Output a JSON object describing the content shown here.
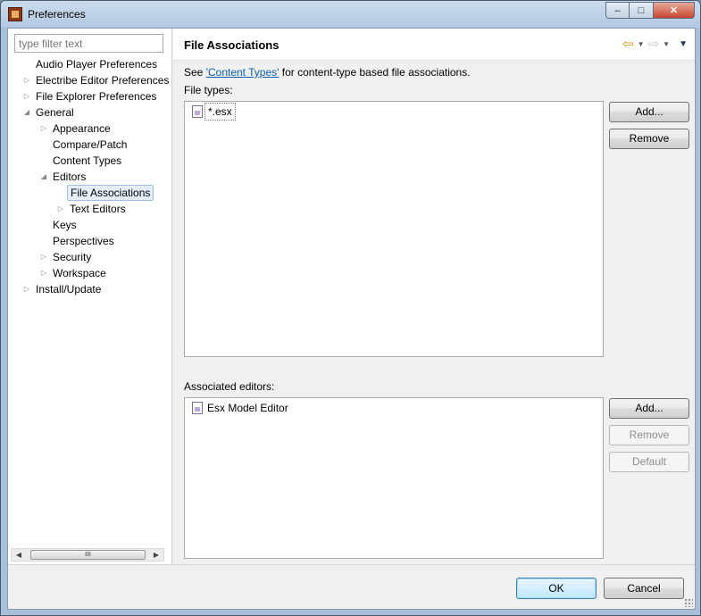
{
  "window": {
    "title": "Preferences",
    "minimize": "–",
    "maximize": "□",
    "close": "✕"
  },
  "filter": {
    "placeholder": "type filter text"
  },
  "tree": [
    {
      "label": "Audio Player Preferences",
      "expandable": false,
      "expanded": false,
      "selected": false
    },
    {
      "label": "Electribe Editor Preferences",
      "expandable": true,
      "expanded": false,
      "selected": false
    },
    {
      "label": "File Explorer Preferences",
      "expandable": true,
      "expanded": false,
      "selected": false
    },
    {
      "label": "General",
      "expandable": true,
      "expanded": true,
      "selected": false
    },
    {
      "label": "Appearance",
      "expandable": true,
      "expanded": false,
      "selected": false
    },
    {
      "label": "Compare/Patch",
      "expandable": false,
      "expanded": false,
      "selected": false
    },
    {
      "label": "Content Types",
      "expandable": false,
      "expanded": false,
      "selected": false
    },
    {
      "label": "Editors",
      "expandable": true,
      "expanded": true,
      "selected": false
    },
    {
      "label": "File Associations",
      "expandable": false,
      "expanded": false,
      "selected": true
    },
    {
      "label": "Text Editors",
      "expandable": true,
      "expanded": false,
      "selected": false
    },
    {
      "label": "Keys",
      "expandable": false,
      "expanded": false,
      "selected": false
    },
    {
      "label": "Perspectives",
      "expandable": false,
      "expanded": false,
      "selected": false
    },
    {
      "label": "Security",
      "expandable": true,
      "expanded": false,
      "selected": false
    },
    {
      "label": "Workspace",
      "expandable": true,
      "expanded": false,
      "selected": false
    },
    {
      "label": "Install/Update",
      "expandable": true,
      "expanded": false,
      "selected": false
    }
  ],
  "page": {
    "title": "File Associations",
    "see_prefix": "See ",
    "see_link": "'Content Types'",
    "see_suffix": " for content-type based file associations.",
    "file_types_label": "File types:",
    "file_types": [
      "*.esx"
    ],
    "file_types_add": "Add...",
    "file_types_remove": "Remove",
    "editors_label": "Associated editors:",
    "editors": [
      "Esx Model Editor"
    ],
    "editors_add": "Add...",
    "editors_remove": "Remove",
    "editors_default": "Default"
  },
  "footer": {
    "ok": "OK",
    "cancel": "Cancel"
  },
  "icons": {
    "back": "arrow-left-icon",
    "forward": "arrow-right-icon",
    "menu": "view-menu-icon",
    "file": "esx-file-icon",
    "expand_collapsed": "▷",
    "expand_expanded": "◢",
    "scroll_grip": "ⅡⅡ"
  }
}
